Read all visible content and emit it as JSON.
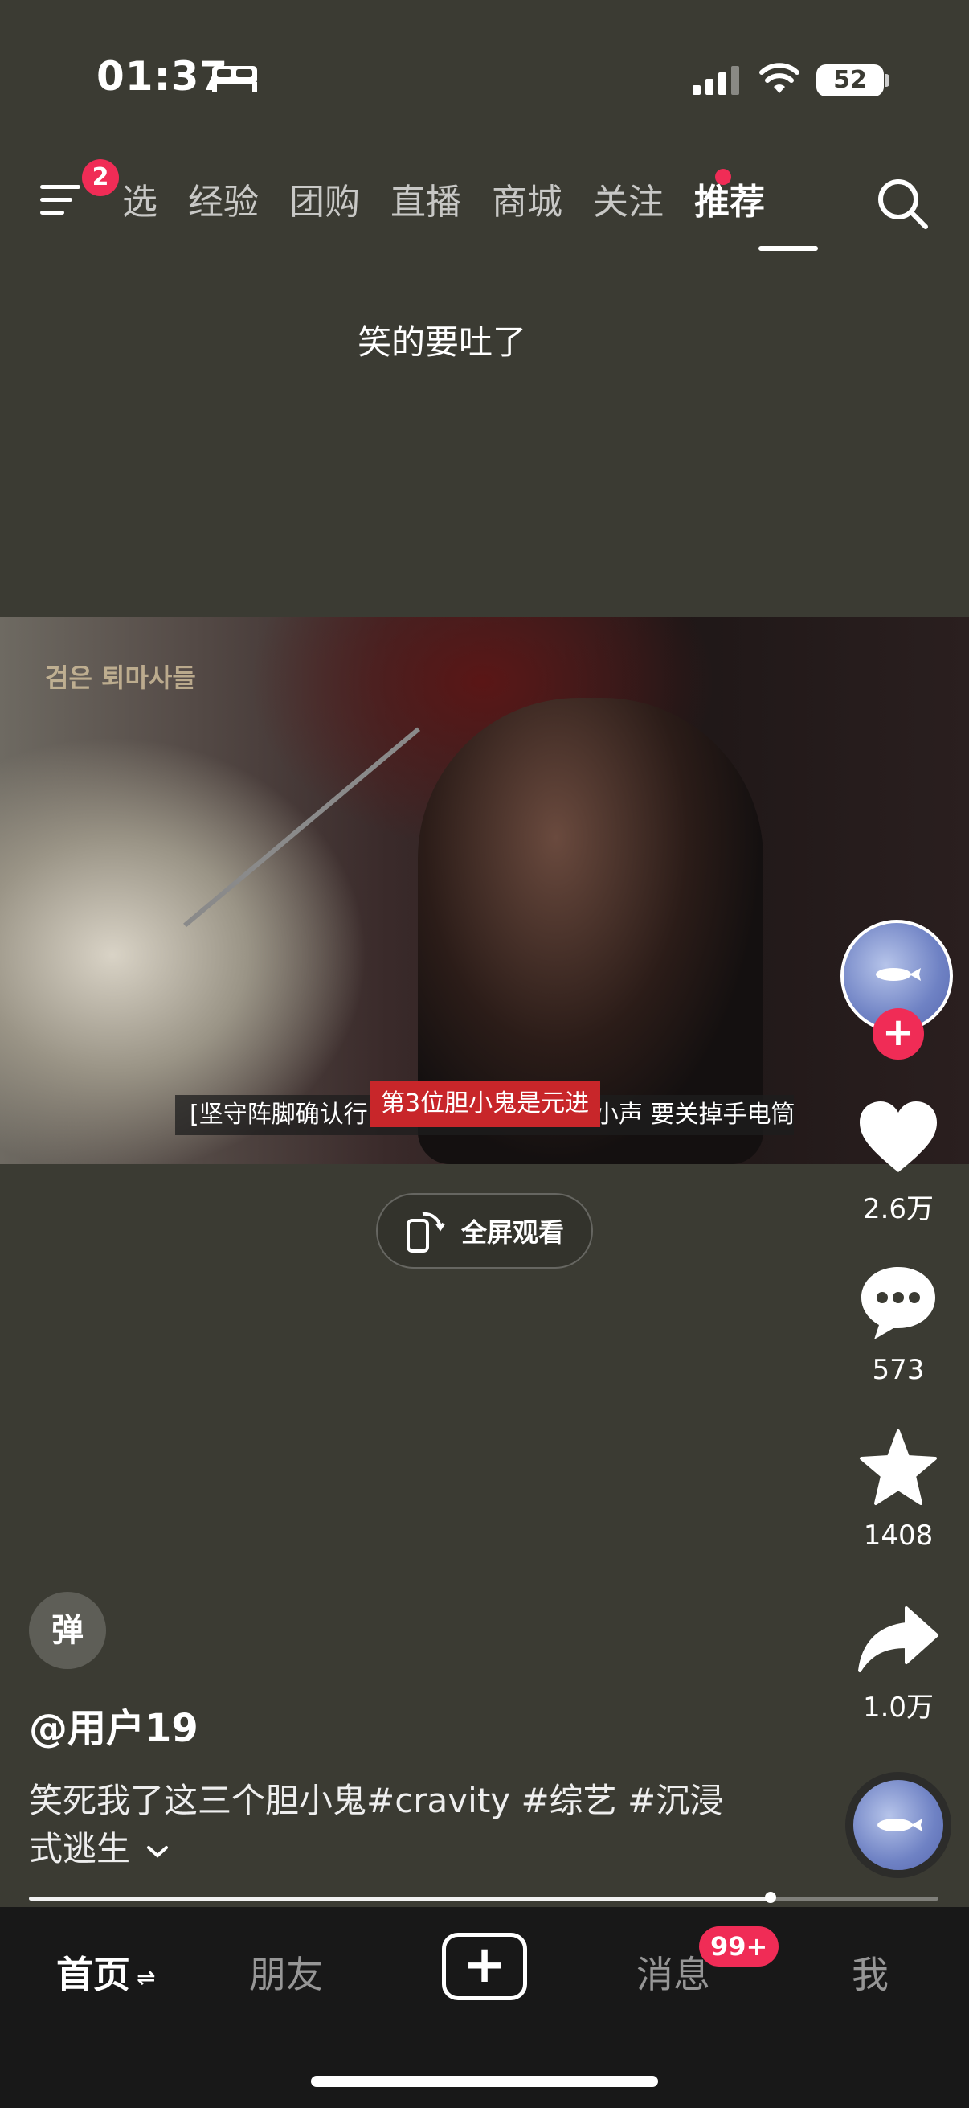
{
  "status_bar": {
    "time": "01:37",
    "battery": "52",
    "icons": [
      "bed-icon",
      "signal-icon",
      "wifi-icon",
      "battery-icon"
    ]
  },
  "top_nav": {
    "menu_badge": "2",
    "tabs": [
      {
        "label": "选",
        "active": false
      },
      {
        "label": "经验",
        "active": false
      },
      {
        "label": "团购",
        "active": false
      },
      {
        "label": "直播",
        "active": false
      },
      {
        "label": "商城",
        "active": false
      },
      {
        "label": "关注",
        "active": false,
        "dot": true
      },
      {
        "label": "推荐",
        "active": true
      }
    ]
  },
  "caption_top": "笑的要吐了",
  "video": {
    "watermark": "검은 퇴마사들",
    "subtitle_left": "[坚守阵脚确认行",
    "subtitle_highlight": "第3位胆小鬼是元进",
    "subtitle_right": "小声 要关掉手电筒",
    "fullscreen_label": "全屏观看"
  },
  "actions": {
    "likes": "2.6万",
    "comments": "573",
    "favorites": "1408",
    "shares": "1.0万",
    "follow_symbol": "+"
  },
  "post": {
    "danmu": "弹",
    "username": "@用户19",
    "description": "笑死我了这三个胆小鬼#cravity #综艺 #沉浸式逃生",
    "expand_icon": "chevron-down-icon",
    "progress": 0.815
  },
  "bottom_nav": {
    "home": "首页",
    "home_suffix": "⇌",
    "friends": "朋友",
    "create": "+",
    "messages": "消息",
    "messages_badge": "99+",
    "me": "我"
  },
  "colors": {
    "background": "#3b3b33",
    "accent": "#f02c56",
    "subtitle_red": "#c8262a",
    "nav_bg": "#181818"
  }
}
